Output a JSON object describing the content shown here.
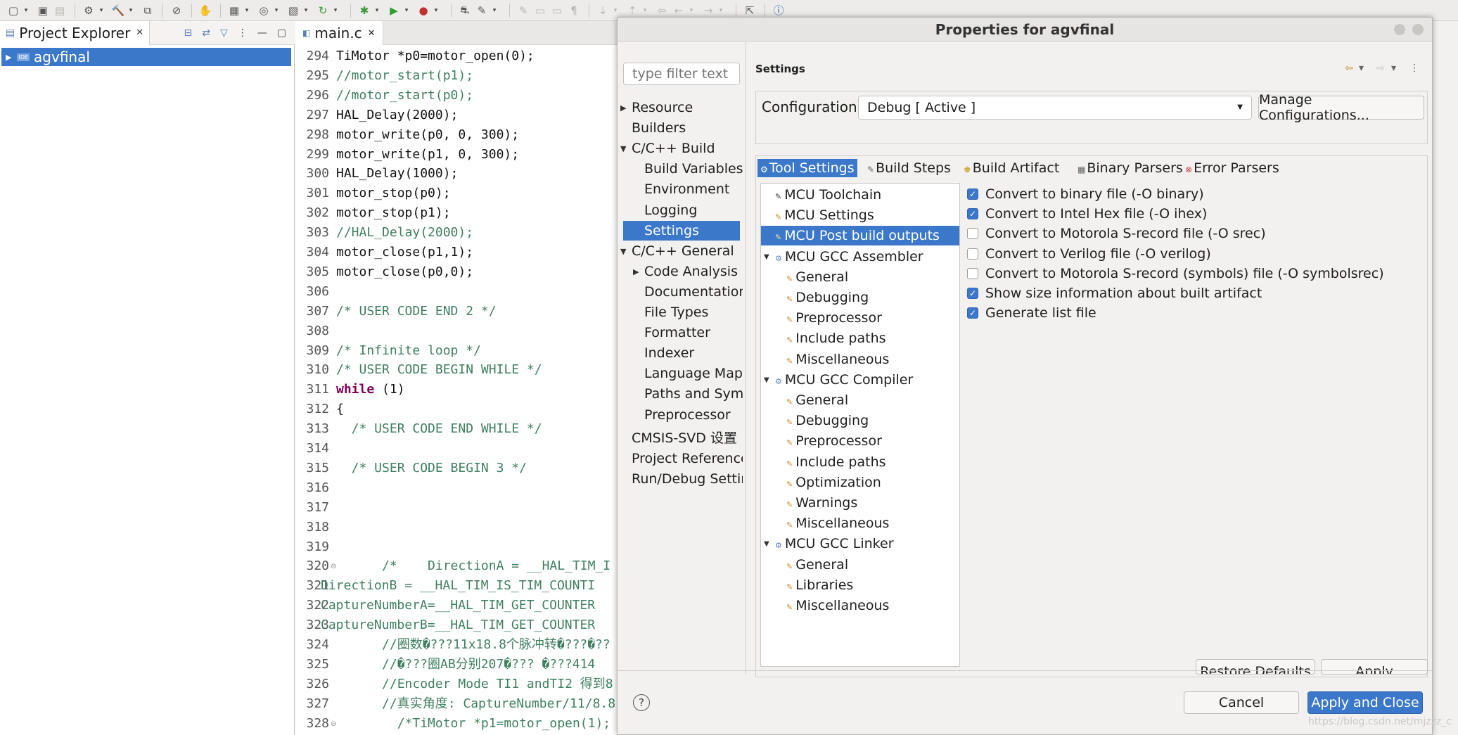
{
  "toolbar": {
    "icons": [
      "new-icon",
      "save-icon",
      "save-all-icon",
      "build-config-icon",
      "build-icon",
      "debug-config-icon",
      "skip-breakpoints-icon",
      "new-project-icon",
      "new-file-icon",
      "new-class-icon",
      "refresh-icon",
      "debug-icon",
      "run-icon",
      "run-config-icon",
      "external-tools-icon",
      "search-icon",
      "open-perspective-icon",
      "info-icon"
    ]
  },
  "explorer": {
    "title": "Project Explorer",
    "project": "agvfinal",
    "project_badge": "IDE"
  },
  "editor": {
    "tab": "main.c",
    "lines": [
      {
        "n": "294",
        "text": "TiMotor *p0=motor_open(0);",
        "cls": ""
      },
      {
        "n": "295",
        "text": "//motor_start(p1);",
        "cls": "cm"
      },
      {
        "n": "296",
        "text": "//motor_start(p0);",
        "cls": "cm"
      },
      {
        "n": "297",
        "text": "HAL_Delay(2000);",
        "cls": ""
      },
      {
        "n": "298",
        "text": "motor_write(p0, 0, 300);",
        "cls": ""
      },
      {
        "n": "299",
        "text": "motor_write(p1, 0, 300);",
        "cls": ""
      },
      {
        "n": "300",
        "text": "HAL_Delay(1000);",
        "cls": ""
      },
      {
        "n": "301",
        "text": "motor_stop(p0);",
        "cls": ""
      },
      {
        "n": "302",
        "text": "motor_stop(p1);",
        "cls": ""
      },
      {
        "n": "303",
        "text": "//HAL_Delay(2000);",
        "cls": "cm"
      },
      {
        "n": "304",
        "text": "motor_close(p1,1);",
        "cls": ""
      },
      {
        "n": "305",
        "text": "motor_close(p0,0);",
        "cls": ""
      },
      {
        "n": "306",
        "text": "",
        "cls": ""
      },
      {
        "n": "307",
        "text": "/* USER CODE END 2 */",
        "cls": "cm"
      },
      {
        "n": "308",
        "text": "",
        "cls": ""
      },
      {
        "n": "309",
        "text": "/* Infinite loop */",
        "cls": "cm"
      },
      {
        "n": "310",
        "text": "/* USER CODE BEGIN WHILE */",
        "cls": "cm"
      },
      {
        "n": "311",
        "text": "while (1)",
        "cls": "kw"
      },
      {
        "n": "312",
        "text": "{",
        "cls": ""
      },
      {
        "n": "313",
        "text": "  /* USER CODE END WHILE */",
        "cls": "cm"
      },
      {
        "n": "314",
        "text": "",
        "cls": ""
      },
      {
        "n": "315",
        "text": "  /* USER CODE BEGIN 3 */",
        "cls": "cm"
      },
      {
        "n": "316",
        "text": "",
        "cls": ""
      },
      {
        "n": "317",
        "text": "",
        "cls": ""
      },
      {
        "n": "318",
        "text": "",
        "cls": ""
      },
      {
        "n": "319",
        "text": "",
        "cls": ""
      },
      {
        "n": "320",
        "text": "      /*    DirectionA = __HAL_TIM_I",
        "cls": "cm"
      },
      {
        "n": "321",
        "text": "DirectionB = __HAL_TIM_IS_TIM_COUNTI",
        "cls": "cm"
      },
      {
        "n": "322",
        "text": "CaptureNumberA=__HAL_TIM_GET_COUNTER",
        "cls": "cm"
      },
      {
        "n": "323",
        "text": "CaptureNumberB=__HAL_TIM_GET_COUNTER",
        "cls": "cm"
      },
      {
        "n": "324",
        "text": "      //圈数�???11x18.8个脉冲转�???�??",
        "cls": "cm"
      },
      {
        "n": "325",
        "text": "      //�???圈AB分别207�??? �???414",
        "cls": "cm"
      },
      {
        "n": "326",
        "text": "      //Encoder Mode TI1 andTI2 得到8",
        "cls": "cm"
      },
      {
        "n": "327",
        "text": "      //真实角度: CaptureNumber/11/8.8",
        "cls": "cm"
      },
      {
        "n": "328",
        "text": "        /*TiMotor *p1=motor_open(1);",
        "cls": "cm"
      }
    ]
  },
  "dialog": {
    "title": "Properties for agvfinal",
    "filter_placeholder": "type filter text",
    "nav": [
      {
        "label": "Resource",
        "level": 1,
        "arrow": "right"
      },
      {
        "label": "Builders",
        "level": 1,
        "arrow": ""
      },
      {
        "label": "C/C++ Build",
        "level": 1,
        "arrow": "down"
      },
      {
        "label": "Build Variables",
        "level": 2,
        "arrow": ""
      },
      {
        "label": "Environment",
        "level": 2,
        "arrow": ""
      },
      {
        "label": "Logging",
        "level": 2,
        "arrow": ""
      },
      {
        "label": "Settings",
        "level": 2,
        "arrow": "",
        "selected": true
      },
      {
        "label": "C/C++ General",
        "level": 1,
        "arrow": "down"
      },
      {
        "label": "Code Analysis",
        "level": 2,
        "arrow": "right"
      },
      {
        "label": "Documentation",
        "level": 2,
        "arrow": ""
      },
      {
        "label": "File Types",
        "level": 2,
        "arrow": ""
      },
      {
        "label": "Formatter",
        "level": 2,
        "arrow": ""
      },
      {
        "label": "Indexer",
        "level": 2,
        "arrow": ""
      },
      {
        "label": "Language Mappings",
        "level": 2,
        "arrow": ""
      },
      {
        "label": "Paths and Symbols",
        "level": 2,
        "arrow": ""
      },
      {
        "label": "Preprocessor",
        "level": 2,
        "arrow": ""
      },
      {
        "label": "CMSIS-SVD 设置",
        "level": 1,
        "arrow": ""
      },
      {
        "label": "Project References",
        "level": 1,
        "arrow": ""
      },
      {
        "label": "Run/Debug Settings",
        "level": 1,
        "arrow": ""
      }
    ],
    "settings_title": "Settings",
    "config_label": "Configuration:",
    "config_value": "Debug  [ Active ]",
    "manage_button": "Manage Configurations...",
    "tabs": [
      {
        "label": "Tool Settings",
        "selected": true
      },
      {
        "label": "Build Steps"
      },
      {
        "label": "Build Artifact"
      },
      {
        "label": "Binary Parsers"
      },
      {
        "label": "Error Parsers"
      }
    ],
    "tool_tree": [
      {
        "label": "MCU Toolchain",
        "level": 0,
        "arrow": ""
      },
      {
        "label": "MCU Settings",
        "level": 0,
        "arrow": ""
      },
      {
        "label": "MCU Post build outputs",
        "level": 0,
        "arrow": "",
        "selected": true
      },
      {
        "label": "MCU GCC Assembler",
        "level": 0,
        "arrow": "down"
      },
      {
        "label": "General",
        "level": 1,
        "arrow": ""
      },
      {
        "label": "Debugging",
        "level": 1,
        "arrow": ""
      },
      {
        "label": "Preprocessor",
        "level": 1,
        "arrow": ""
      },
      {
        "label": "Include paths",
        "level": 1,
        "arrow": ""
      },
      {
        "label": "Miscellaneous",
        "level": 1,
        "arrow": ""
      },
      {
        "label": "MCU GCC Compiler",
        "level": 0,
        "arrow": "down"
      },
      {
        "label": "General",
        "level": 1,
        "arrow": ""
      },
      {
        "label": "Debugging",
        "level": 1,
        "arrow": ""
      },
      {
        "label": "Preprocessor",
        "level": 1,
        "arrow": ""
      },
      {
        "label": "Include paths",
        "level": 1,
        "arrow": ""
      },
      {
        "label": "Optimization",
        "level": 1,
        "arrow": ""
      },
      {
        "label": "Warnings",
        "level": 1,
        "arrow": ""
      },
      {
        "label": "Miscellaneous",
        "level": 1,
        "arrow": ""
      },
      {
        "label": "MCU GCC Linker",
        "level": 0,
        "arrow": "down"
      },
      {
        "label": "General",
        "level": 1,
        "arrow": ""
      },
      {
        "label": "Libraries",
        "level": 1,
        "arrow": ""
      },
      {
        "label": "Miscellaneous",
        "level": 1,
        "arrow": ""
      }
    ],
    "options": [
      {
        "label": "Convert to binary file (-O binary)",
        "checked": true
      },
      {
        "label": "Convert to Intel Hex file (-O ihex)",
        "checked": true
      },
      {
        "label": "Convert to Motorola S-record file (-O srec)",
        "checked": false
      },
      {
        "label": "Convert to Verilog file (-O verilog)",
        "checked": false
      },
      {
        "label": "Convert to Motorola S-record (symbols) file (-O symbolsrec)",
        "checked": false
      },
      {
        "label": "Show size information about built artifact",
        "checked": true
      },
      {
        "label": "Generate list file",
        "checked": true
      }
    ],
    "restore_button": "Restore Defaults",
    "apply_button": "Apply",
    "cancel_button": "Cancel",
    "apply_close_button": "Apply and Close",
    "help_glyph": "?"
  },
  "watermark": "https://blog.csdn.net/mjzzz_c"
}
